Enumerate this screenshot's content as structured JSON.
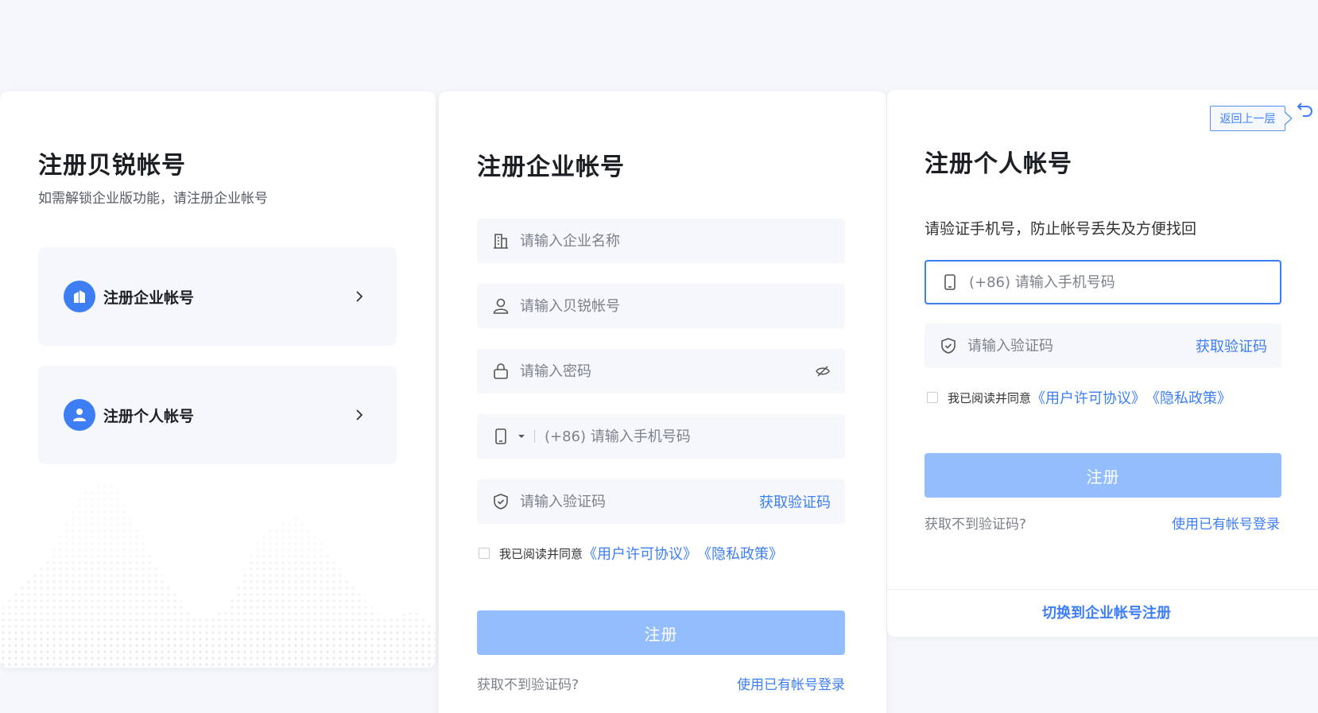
{
  "choose": {
    "title": "注册贝锐帐号",
    "subtitle": "如需解锁企业版功能，请注册企业帐号",
    "company_label": "注册企业帐号",
    "personal_label": "注册个人帐号"
  },
  "company": {
    "title": "注册企业帐号",
    "company_name_placeholder": "请输入企业名称",
    "account_placeholder": "请输入贝锐帐号",
    "password_placeholder": "请输入密码",
    "phone_placeholder": "(+86) 请输入手机号码",
    "code_placeholder": "请输入验证码",
    "get_code": "获取验证码",
    "agree_text": "我已阅读并同意",
    "license_link": "《用户许可协议》",
    "privacy_link": "《隐私政策》",
    "submit": "注册",
    "no_code": "获取不到验证码?",
    "login_existing": "使用已有帐号登录"
  },
  "personal": {
    "back_label": "返回上一层",
    "title": "注册个人帐号",
    "subtitle": "请验证手机号，防止帐号丢失及方便找回",
    "phone_placeholder": "(+86) 请输入手机号码",
    "code_placeholder": "请输入验证码",
    "get_code": "获取验证码",
    "agree_text": "我已阅读并同意",
    "license_link": "《用户许可协议》",
    "privacy_link": "《隐私政策》",
    "submit": "注册",
    "no_code": "获取不到验证码?",
    "login_existing": "使用已有帐号登录",
    "switch": "切换到企业帐号注册"
  },
  "colors": {
    "accent": "#3d7ef5",
    "button_disabled": "#93bdfc",
    "background": "#f5f7fb"
  }
}
